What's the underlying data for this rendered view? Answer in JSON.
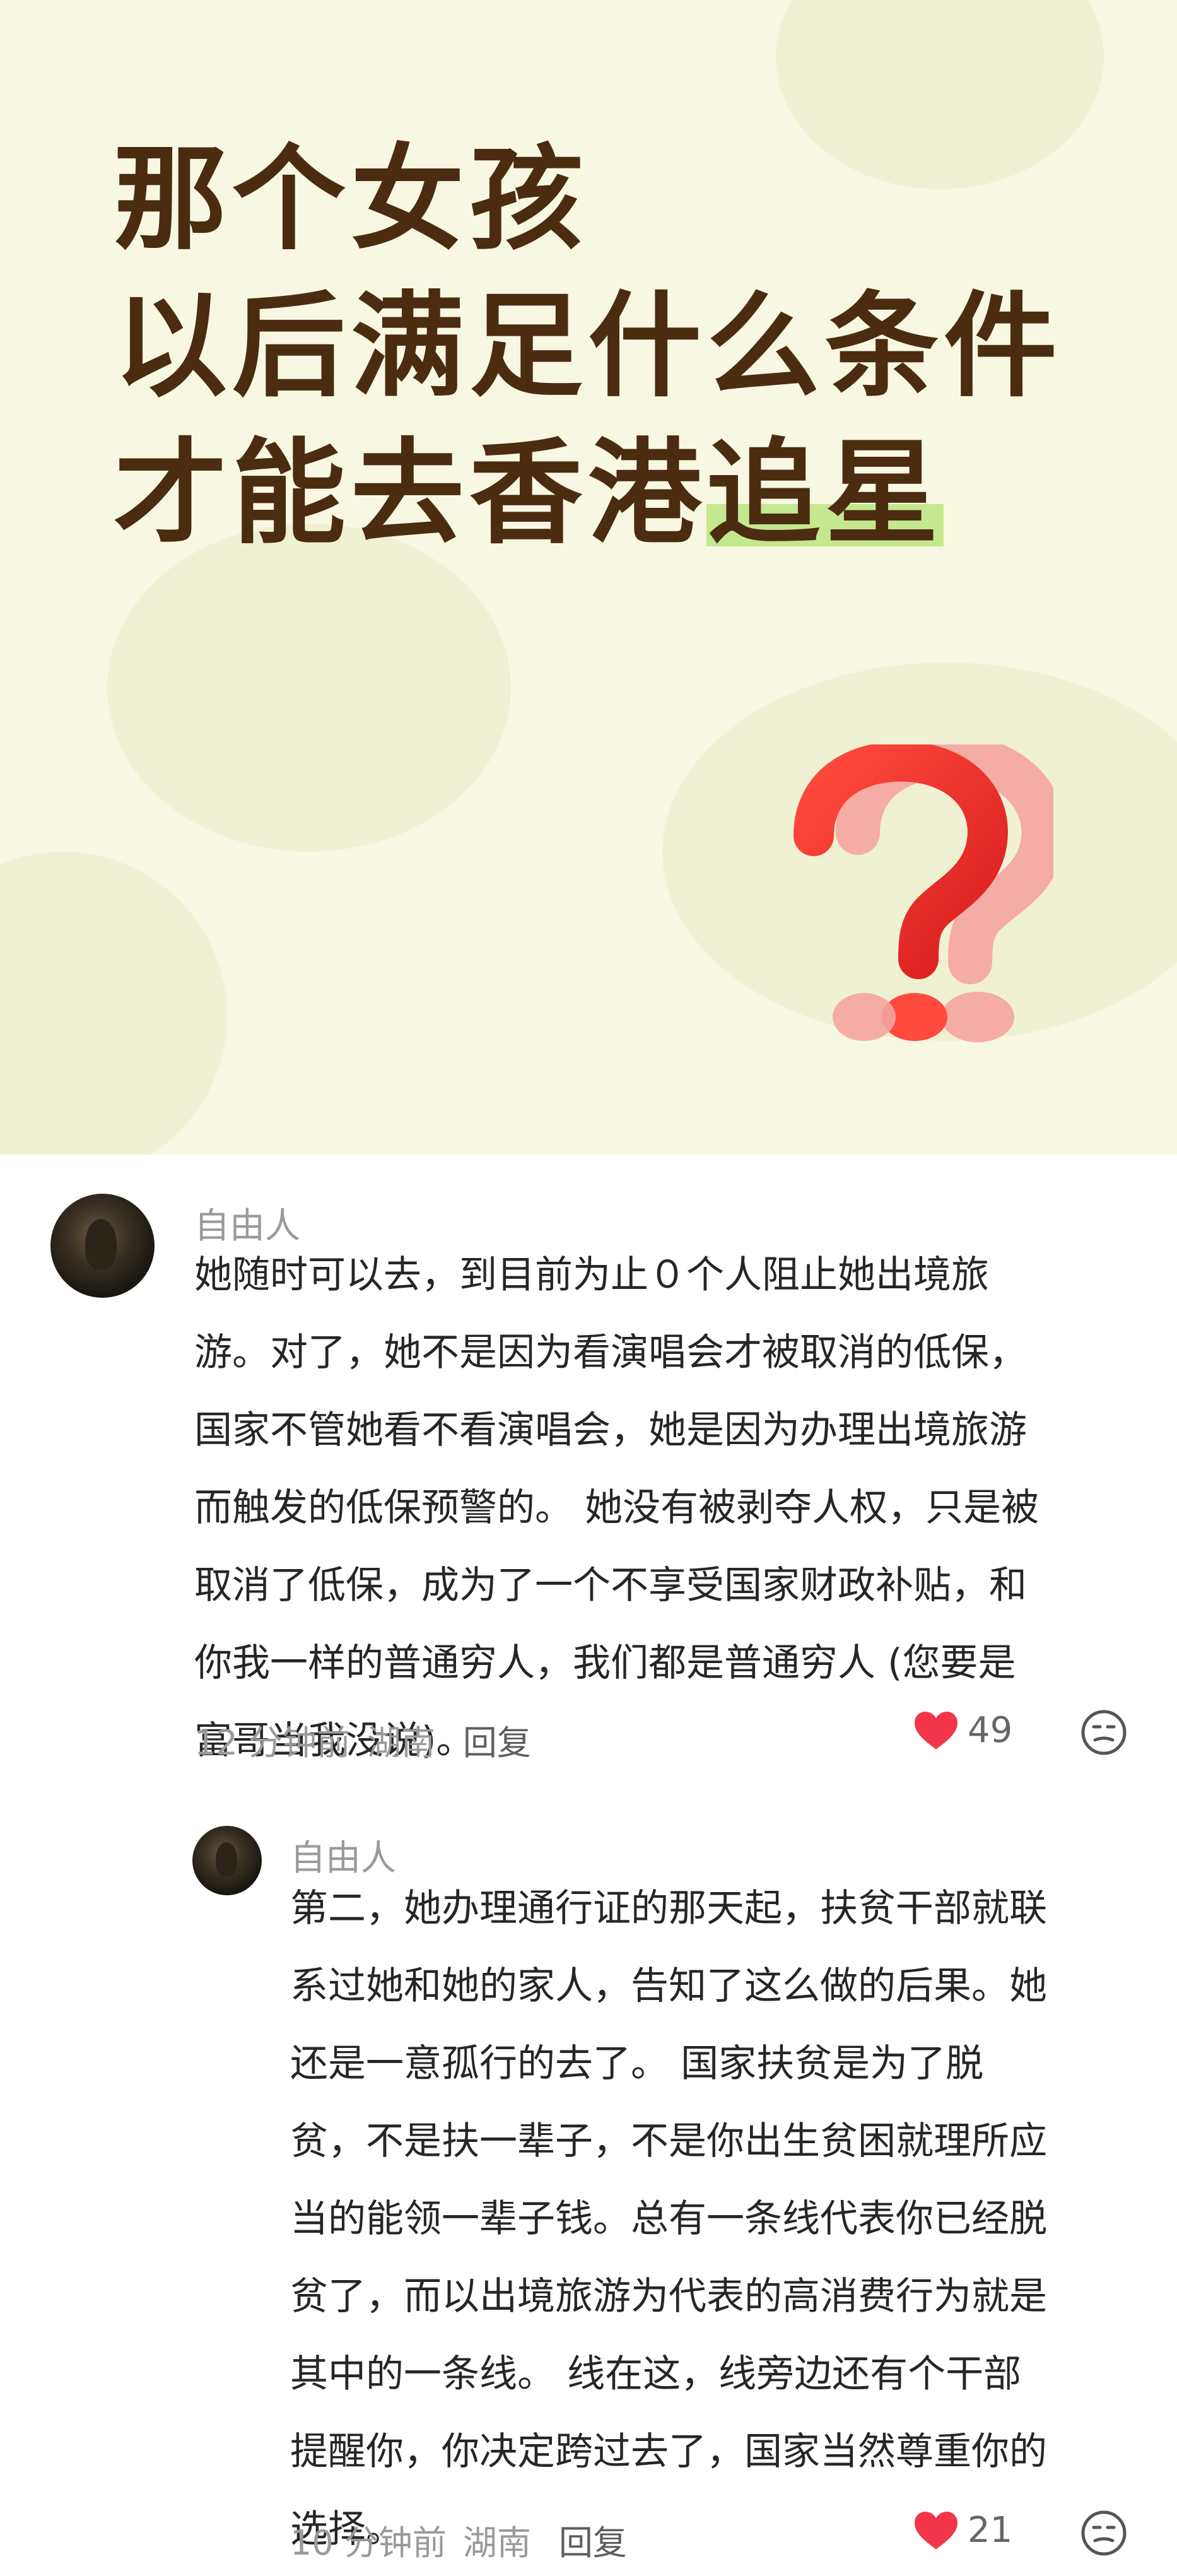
{
  "banner": {
    "headline_lines": [
      "那个女孩",
      "以后满足什么条件",
      "才能去香港"
    ],
    "headline_highlight": "追星",
    "highlight_color": "#c4e890",
    "background_color": "#f8f8e2",
    "title_color": "#4b2c10",
    "decoration_icon": "question-mark-icon"
  },
  "comments": [
    {
      "username": "自由人",
      "lines": [
        "她随时可以去，到目前为止０个人阻止她出境旅",
        "游。对了，她不是因为看演唱会才被取消的低保，",
        "国家不管她看不看演唱会，她是因为办理出境旅游",
        "而触发的低保预警的。 她没有被剥夺人权，只是被",
        "取消了低保，成为了一个不享受国家财政补贴，和",
        "你我一样的普通穷人，我们都是普通穷人 (您要是",
        "富哥当我没说)。"
      ],
      "time": "12 分钟前",
      "location": "湖南",
      "reply_label": "回复",
      "likes": "49"
    },
    {
      "username": "自由人",
      "lines": [
        "第二，她办理通行证的那天起，扶贫干部就联",
        "系过她和她的家人，告知了这么做的后果。她",
        "还是一意孤行的去了。 国家扶贫是为了脱",
        "贫，不是扶一辈子，不是你出生贫困就理所应",
        "当的能领一辈子钱。总有一条线代表你已经脱",
        "贫了，而以出境旅游为代表的高消费行为就是",
        "其中的一条线。 线在这，线旁边还有个干部",
        "提醒你，你决定跨过去了，国家当然尊重你的",
        "选择。"
      ],
      "time": "10 分钟前",
      "location": "湖南",
      "reply_label": "回复",
      "likes": "21"
    }
  ],
  "colors": {
    "like_heart": "#f2354a",
    "meta_text": "#9a9a9a",
    "body_text": "#262626"
  }
}
